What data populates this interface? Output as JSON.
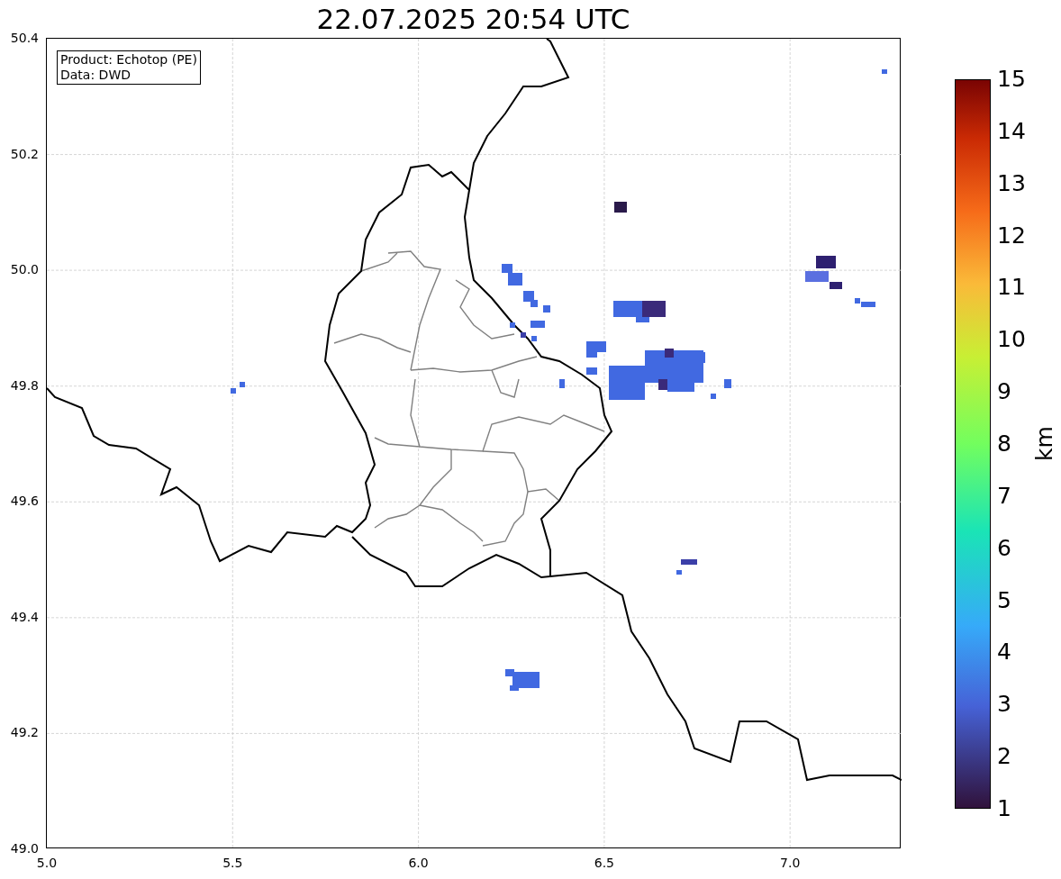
{
  "title": "22.07.2025 20:54 UTC",
  "info_box": {
    "lines": [
      "Product: Echotop (PE)",
      "Data: DWD"
    ]
  },
  "y_axis": {
    "ticks": [
      "50.4",
      "50.2",
      "50.0",
      "49.8",
      "49.6",
      "49.4",
      "49.2",
      "49.0"
    ]
  },
  "x_axis": {
    "ticks": [
      "5.0",
      "5.5",
      "6.0",
      "6.5",
      "7.0"
    ]
  },
  "colorbar": {
    "label": "km",
    "ticks": [
      "15",
      "14",
      "13",
      "12",
      "11",
      "10",
      "9",
      "8",
      "7",
      "6",
      "5",
      "4",
      "3",
      "2",
      "1"
    ]
  }
}
